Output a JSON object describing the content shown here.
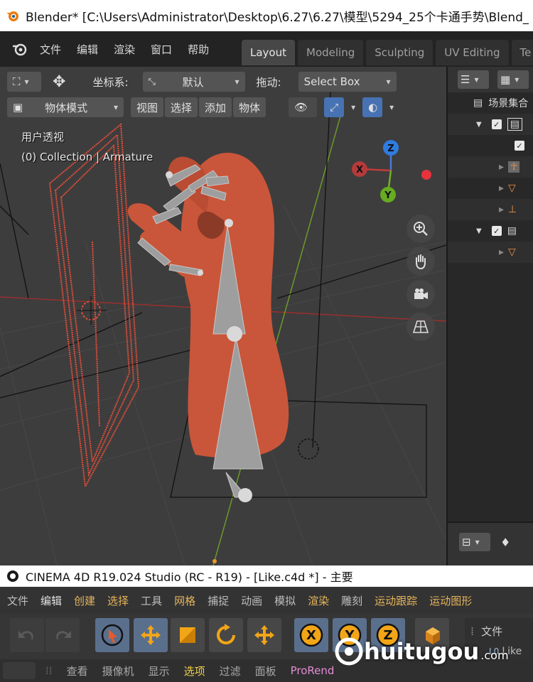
{
  "blender": {
    "window_title": "Blender* [C:\\Users\\Administrator\\Desktop\\6.27\\6.27\\模型\\5294_25个卡通手势\\Blend_",
    "menu": [
      "文件",
      "编辑",
      "渲染",
      "窗口",
      "帮助"
    ],
    "workspaces": [
      "Layout",
      "Modeling",
      "Sculpting",
      "UV Editing",
      "Te"
    ],
    "active_workspace": "Layout",
    "toolbar": {
      "coord_label": "坐标系:",
      "coord_value": "默认",
      "drag_label": "拖动:",
      "drag_value": "Select Box",
      "mode_value": "物体模式",
      "view": "视图",
      "select": "选择",
      "add": "添加",
      "object": "物体"
    },
    "viewport": {
      "view_name": "用户透视",
      "collection_info": "(0) Collection | Armature",
      "gizmo": {
        "z": "Z",
        "x": "X",
        "y": "Y"
      }
    },
    "outliner": {
      "scene_collection": "场景集合",
      "colors": {
        "selected_bg": "#6a6a6a",
        "armature_orange": "#e8904a"
      }
    },
    "colors": {
      "hand": "#c9563a",
      "light_lines": "#e24e3a",
      "axis_red": "#b33434",
      "axis_green": "#6a9a2a"
    }
  },
  "cinema4d": {
    "window_title": "CINEMA 4D R19.024 Studio (RC - R19) - [Like.c4d *] - 主要",
    "menu": [
      "文件",
      "编辑",
      "创建",
      "选择",
      "工具",
      "网格",
      "捕捉",
      "动画",
      "模拟",
      "渲染",
      "雕刻",
      "运动跟踪",
      "运动图形"
    ],
    "menu_highlight": [
      false,
      false,
      true,
      true,
      false,
      true,
      false,
      false,
      false,
      true,
      false,
      true,
      true
    ],
    "axis_buttons": [
      "X",
      "Y",
      "Z"
    ],
    "panel": {
      "file": "文件",
      "item": "Like"
    },
    "bottom": [
      "查看",
      "摄像机",
      "显示",
      "选项",
      "过滤",
      "面板",
      "ProRend"
    ]
  },
  "watermark": {
    "brand": "huitugou",
    "suffix": ".com"
  }
}
